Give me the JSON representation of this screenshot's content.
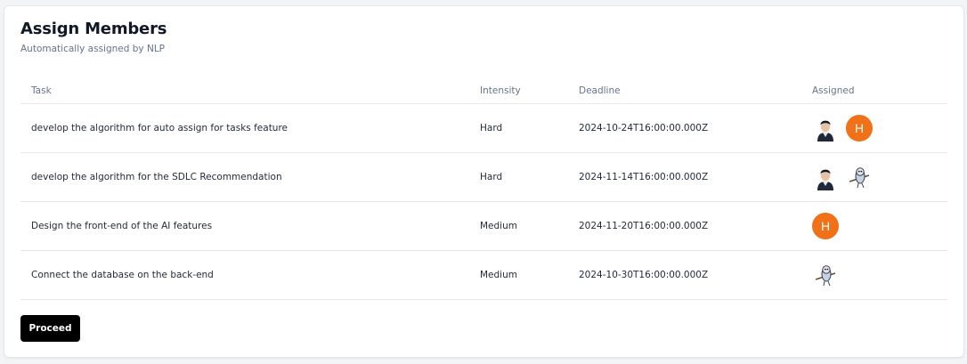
{
  "header": {
    "title": "Assign Members",
    "subtitle": "Automatically assigned by NLP"
  },
  "table": {
    "columns": {
      "task": "Task",
      "intensity": "Intensity",
      "deadline": "Deadline",
      "assigned": "Assigned"
    },
    "rows": [
      {
        "task": "develop the algorithm for auto assign for tasks feature",
        "intensity": "Hard",
        "deadline": "2024-10-24T16:00:00.000Z",
        "assigned": [
          {
            "type": "photo",
            "icon": "person-photo-avatar"
          },
          {
            "type": "letter",
            "letter": "H",
            "color": "#f07117"
          }
        ]
      },
      {
        "task": "develop the algorithm for the SDLC Recommendation",
        "intensity": "Hard",
        "deadline": "2024-11-14T16:00:00.000Z",
        "assigned": [
          {
            "type": "photo",
            "icon": "person-photo-avatar"
          },
          {
            "type": "photo",
            "icon": "bird-cartoon-avatar"
          }
        ]
      },
      {
        "task": "Design the front-end of the AI features",
        "intensity": "Medium",
        "deadline": "2024-11-20T16:00:00.000Z",
        "assigned": [
          {
            "type": "letter",
            "letter": "H",
            "color": "#f07117"
          }
        ]
      },
      {
        "task": "Connect the database on the back-end",
        "intensity": "Medium",
        "deadline": "2024-10-30T16:00:00.000Z",
        "assigned": [
          {
            "type": "photo",
            "icon": "bird-cartoon-avatar"
          }
        ]
      }
    ]
  },
  "actions": {
    "proceed_label": "Proceed"
  }
}
